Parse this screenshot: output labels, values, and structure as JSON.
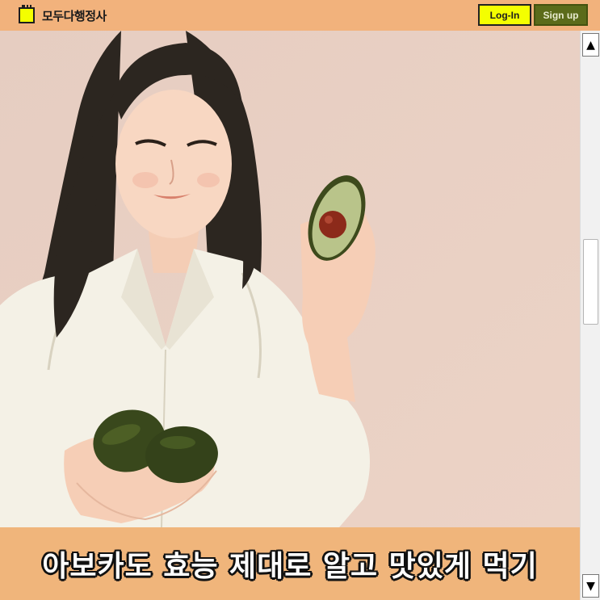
{
  "header": {
    "logo_text": "모두다행정사",
    "login_label": "Log-In",
    "signup_label": "Sign up"
  },
  "hero": {
    "caption": "아보카도 효능 제대로 알고 맛있게 먹기"
  },
  "scrollbar": {
    "up_icon": "▲",
    "down_icon": "▼"
  }
}
